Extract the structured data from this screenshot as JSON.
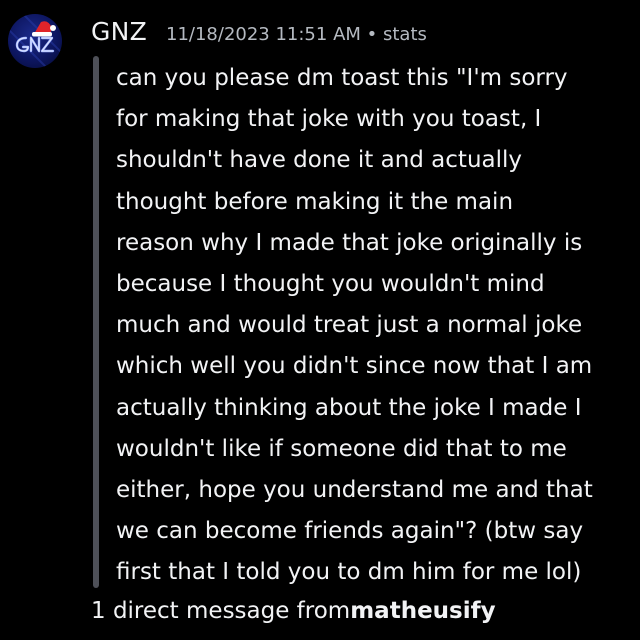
{
  "message": {
    "author": "GNZ",
    "timestamp": "11/18/2023 11:51 AM",
    "separator": "•",
    "channel": "stats",
    "body": "can you please dm toast this \"I'm sorry\nfor making that joke with you toast, I\nshouldn't have done it and actually\nthought before making it the main\nreason why I made that joke originally is\nbecause I thought you wouldn't mind\nmuch and would treat just a normal joke\nwhich well you didn't since now that I am\nactually thinking about the joke I made I\nwouldn't like if someone did that to me\neither, hope you understand me and that\nwe can become friends again\"? (btw say\nfirst that I told you to dm him for me lol)"
  },
  "avatar": {
    "text": "GNZ",
    "icon": "santa-hat-icon"
  },
  "footer": {
    "prefix": "1 direct message from",
    "user": "matheusify"
  },
  "colors": {
    "background": "#000000",
    "text": "#f2f3f5",
    "muted": "#b5bac1",
    "quote_bar": "#4e5058",
    "avatar_bg": "#0d1660",
    "hat_red": "#e0242a"
  }
}
